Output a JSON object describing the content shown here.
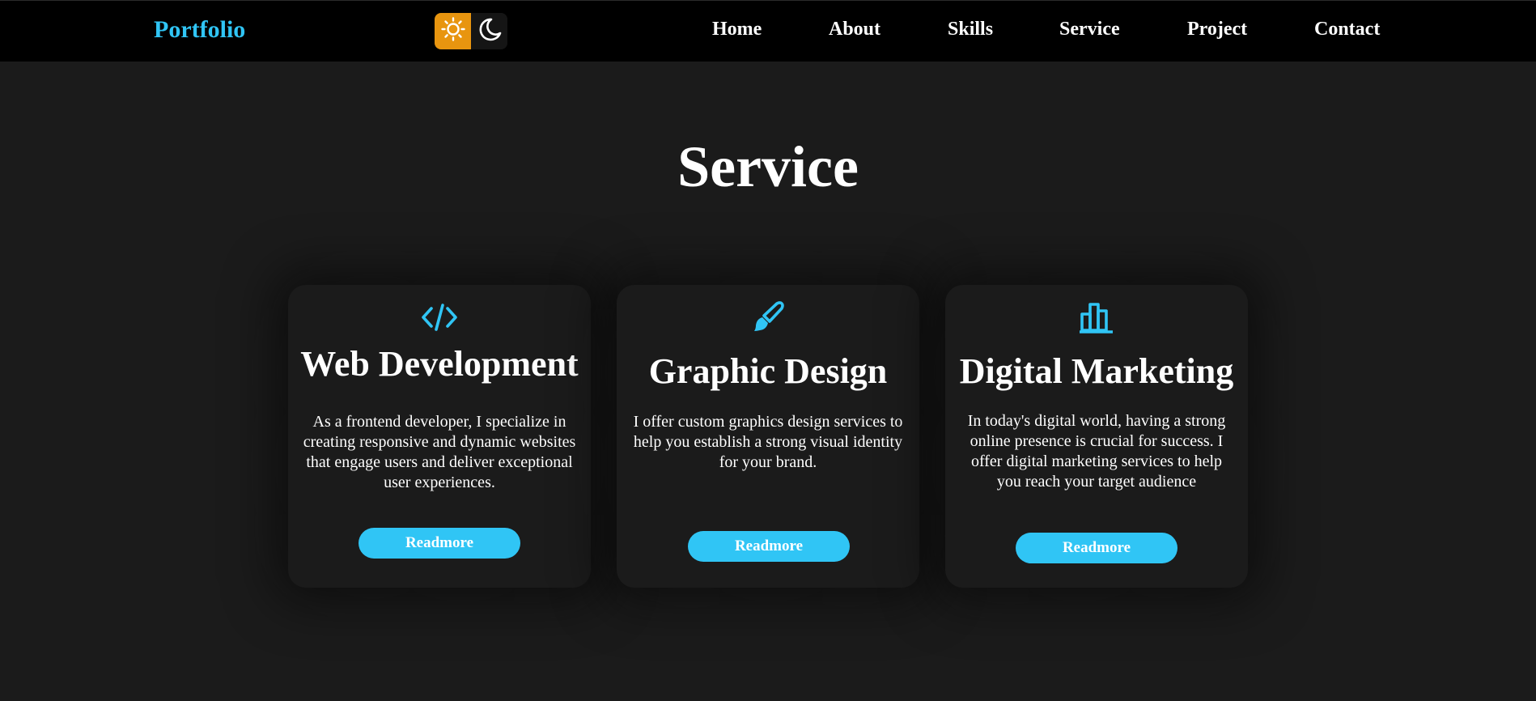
{
  "header": {
    "logo": "Portfolio",
    "theme_toggle": {
      "light_icon": "sun-icon",
      "dark_icon": "moon-icon",
      "active": "light"
    },
    "nav": [
      {
        "label": "Home"
      },
      {
        "label": "About"
      },
      {
        "label": "Skills"
      },
      {
        "label": "Service"
      },
      {
        "label": "Project"
      },
      {
        "label": "Contact"
      }
    ]
  },
  "service": {
    "title": "Service",
    "cards": [
      {
        "icon": "code-icon",
        "title": "Web Development",
        "text": "As a frontend developer, I specialize in creating responsive and dynamic websites that engage users and deliver exceptional user experiences.",
        "button": "Readmore"
      },
      {
        "icon": "paintbrush-icon",
        "title": "Graphic Design",
        "text": "I offer custom graphics design services to help you establish a strong visual identity for your brand.",
        "button": "Readmore"
      },
      {
        "icon": "bar-chart-icon",
        "title": "Digital Marketing",
        "text": "In today's digital world, having a strong online presence is crucial for success. I offer digital marketing services to help you reach your target audience",
        "button": "Readmore"
      }
    ]
  },
  "colors": {
    "accent": "#30c5f5",
    "sun_bg": "#e8950f",
    "page_bg": "#1b1b1b",
    "nav_bg": "#000000"
  }
}
